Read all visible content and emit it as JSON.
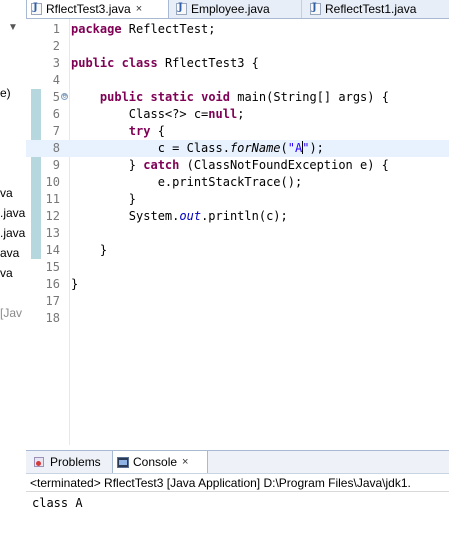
{
  "left_panel": {
    "fragments": [
      "e)",
      "va",
      ".java",
      ".java",
      "ava",
      "va",
      "[Jav"
    ]
  },
  "editor_tabs": [
    {
      "label": "RflectTest3.java",
      "active": true
    },
    {
      "label": "Employee.java",
      "active": false
    },
    {
      "label": "ReflectTest1.java",
      "active": false
    }
  ],
  "code_lines": [
    {
      "n": "1",
      "tokens": [
        {
          "t": "package",
          "c": "kw"
        },
        {
          "t": " ReflectTest;"
        }
      ]
    },
    {
      "n": "2",
      "tokens": []
    },
    {
      "n": "3",
      "tokens": [
        {
          "t": "public",
          "c": "kw"
        },
        {
          "t": " "
        },
        {
          "t": "class",
          "c": "kw"
        },
        {
          "t": " RflectTest3 {"
        }
      ]
    },
    {
      "n": "4",
      "tokens": []
    },
    {
      "n": "5",
      "tokens": [
        {
          "t": "    "
        },
        {
          "t": "public",
          "c": "kw"
        },
        {
          "t": " "
        },
        {
          "t": "static",
          "c": "kw"
        },
        {
          "t": " "
        },
        {
          "t": "void",
          "c": "kw"
        },
        {
          "t": " main(String[] args) {"
        }
      ]
    },
    {
      "n": "6",
      "tokens": [
        {
          "t": "        Class<?> c="
        },
        {
          "t": "null",
          "c": "kw"
        },
        {
          "t": ";"
        }
      ]
    },
    {
      "n": "7",
      "tokens": [
        {
          "t": "        "
        },
        {
          "t": "try",
          "c": "kw"
        },
        {
          "t": " {"
        }
      ]
    },
    {
      "n": "8",
      "tokens": [
        {
          "t": "            c = Class."
        },
        {
          "t": "forName",
          "c": "meth"
        },
        {
          "t": "("
        },
        {
          "t": "\"A",
          "c": "str"
        },
        {
          "t": "",
          "c": "caret"
        },
        {
          "t": "\"",
          "c": "str"
        },
        {
          "t": ");"
        }
      ]
    },
    {
      "n": "9",
      "tokens": [
        {
          "t": "        } "
        },
        {
          "t": "catch",
          "c": "kw"
        },
        {
          "t": " (ClassNotFoundException e) {"
        }
      ]
    },
    {
      "n": "10",
      "tokens": [
        {
          "t": "            e.printStackTrace();"
        }
      ]
    },
    {
      "n": "11",
      "tokens": [
        {
          "t": "        }"
        }
      ]
    },
    {
      "n": "12",
      "tokens": [
        {
          "t": "        System."
        },
        {
          "t": "out",
          "c": "static"
        },
        {
          "t": ".println(c);"
        }
      ]
    },
    {
      "n": "13",
      "tokens": []
    },
    {
      "n": "14",
      "tokens": [
        {
          "t": "    }"
        }
      ]
    },
    {
      "n": "15",
      "tokens": []
    },
    {
      "n": "16",
      "tokens": [
        {
          "t": "}"
        }
      ]
    },
    {
      "n": "17",
      "tokens": []
    },
    {
      "n": "18",
      "tokens": []
    }
  ],
  "current_line": "8",
  "fold_marker_line": "5",
  "fold_marker": "⊖",
  "bottom_tabs": [
    {
      "label": "Problems",
      "active": false
    },
    {
      "label": "Console",
      "active": true
    }
  ],
  "tab_close_glyph": "×",
  "console": {
    "status": "<terminated> RflectTest3 [Java Application] D:\\Program Files\\Java\\jdk1.",
    "output": "class A"
  },
  "colors": {
    "keyword": "#7f0055",
    "string": "#2a00ff",
    "static_field": "#0000c0",
    "current_line_bg": "#e8f2fe",
    "tab_bar_bg": "#e8eef7"
  }
}
